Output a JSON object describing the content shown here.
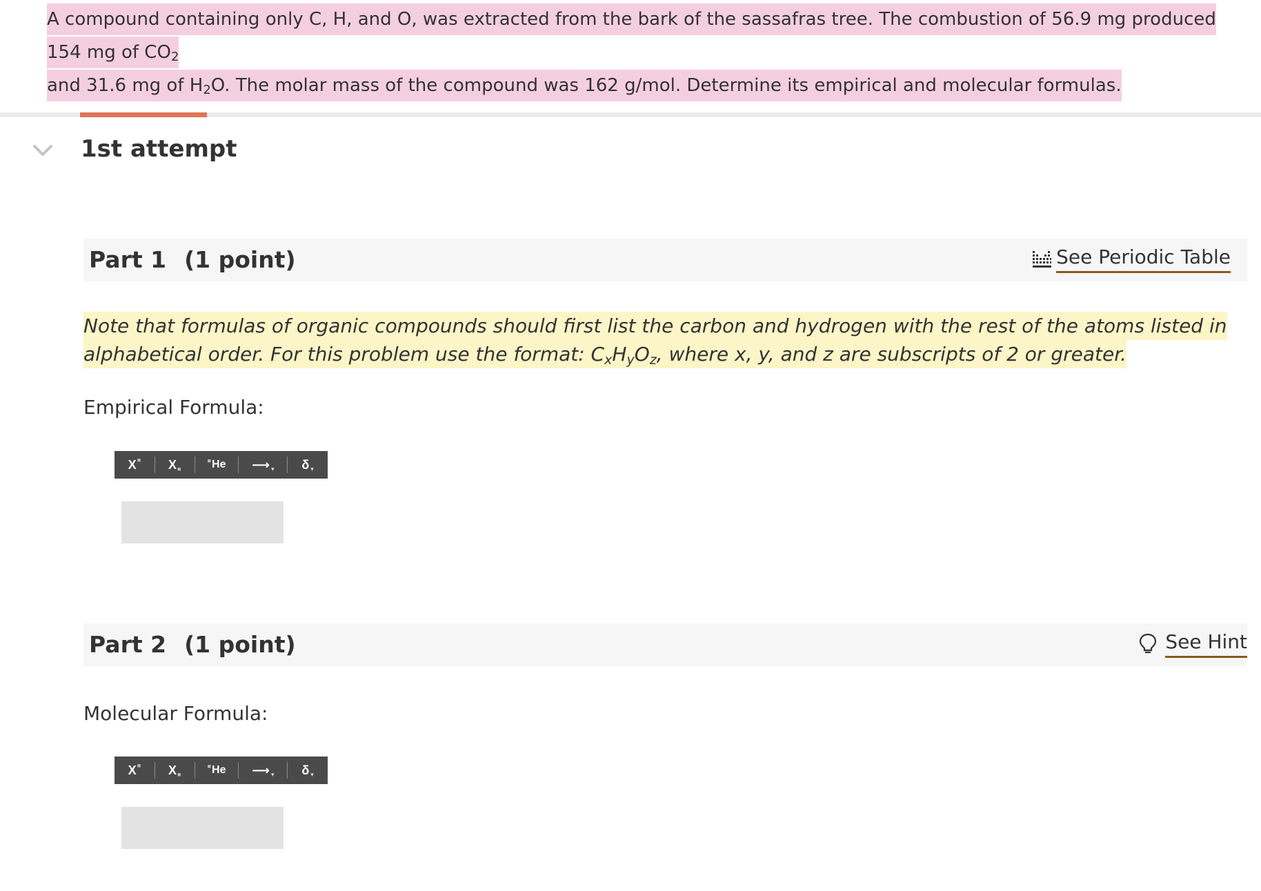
{
  "question": {
    "line1_a": "A compound containing only C, H, and O, was extracted from the bark of the sassafras tree. The combustion of 56.9  mg produced 154  mg of CO",
    "line1_sub": "2",
    "line2_a": "and 31.6  mg of H",
    "line2_sub": "2",
    "line2_b": "O. The molar mass of the compound was 162 g/mol. Determine its empirical and molecular formulas."
  },
  "attempt": {
    "title": "1st attempt",
    "chevron_icon": "chevron-down-icon"
  },
  "part1": {
    "label": "Part 1",
    "points": "(1 point)",
    "link_label": "See Periodic Table",
    "link_icon": "periodic-table-icon",
    "note": {
      "text1": "Note that formulas of organic compounds should first list the carbon and hydrogen with the rest of the atoms listed in alphabetical order. For this problem use the format: C",
      "sub_x": "x",
      "h": "H",
      "sub_y": "y",
      "o": "O",
      "sub_z": "z",
      "text2": ", where x, y, and z are subscripts of 2 or greater."
    },
    "field_label": "Empirical Formula:",
    "answer_value": ""
  },
  "part2": {
    "label": "Part 2",
    "points": "(1 point)",
    "link_label": "See Hint",
    "link_icon": "lightbulb-icon",
    "field_label": "Molecular Formula:",
    "answer_value": ""
  },
  "toolbar": {
    "superscript": "X",
    "subscript": "X",
    "element": "He",
    "arrow": "⟶",
    "delta": "δ",
    "caret": "▾"
  },
  "colors": {
    "question_highlight": "#f4cfe0",
    "note_highlight": "#fbf5c7",
    "accent": "#e07456",
    "link_underline": "#8a5a1f",
    "toolbar_bg": "#4a4a4a",
    "answer_box": "#e3e3e3"
  }
}
